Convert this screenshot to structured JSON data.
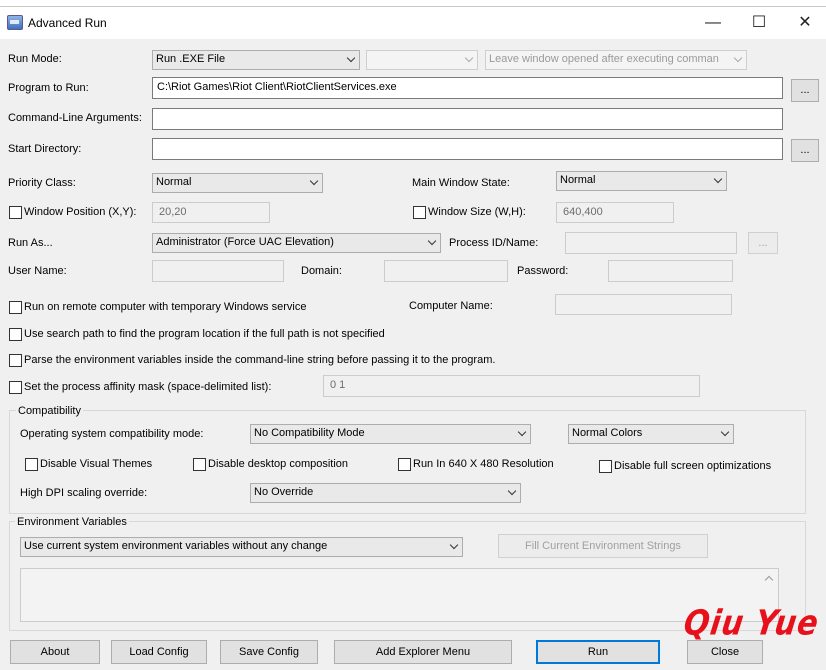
{
  "window": {
    "title": "Advanced Run",
    "controls": {
      "minimize": "—",
      "maximize": "☐",
      "close": "✕"
    }
  },
  "run_mode": {
    "label": "Run Mode:",
    "value": "Run .EXE File",
    "second_combo": "",
    "window_option": "Leave window opened after executing comman"
  },
  "program": {
    "label": "Program to Run:",
    "value": "C:\\Riot Games\\Riot Client\\RiotClientServices.exe",
    "browse": "..."
  },
  "arguments": {
    "label": "Command-Line Arguments:",
    "value": ""
  },
  "start_dir": {
    "label": "Start Directory:",
    "value": "",
    "browse": "..."
  },
  "priority": {
    "label": "Priority Class:",
    "value": "Normal"
  },
  "main_window_state": {
    "label": "Main Window State:",
    "value": "Normal"
  },
  "window_position": {
    "label": "Window Position (X,Y):",
    "value": "20,20",
    "checked": false
  },
  "window_size": {
    "label": "Window Size (W,H):",
    "value": "640,400",
    "checked": false
  },
  "run_as": {
    "label": "Run As...",
    "value": "Administrator (Force UAC Elevation)"
  },
  "process_id": {
    "label": "Process ID/Name:",
    "value": "",
    "browse": "..."
  },
  "credentials": {
    "user_label": "User Name:",
    "domain_label": "Domain:",
    "password_label": "Password:"
  },
  "remote": {
    "label": "Run on remote computer with temporary Windows service",
    "checked": false,
    "computer_label": "Computer Name:"
  },
  "options": [
    {
      "label": "Use search path to find the program location if the full path is not specified",
      "checked": false
    },
    {
      "label": "Parse the environment variables inside the command-line string before passing it to the program.",
      "checked": false
    }
  ],
  "affinity": {
    "label": "Set the process affinity mask (space-delimited list):",
    "value": "0 1",
    "checked": false
  },
  "compatibility": {
    "title": "Compatibility",
    "os_mode_label": "Operating system compatibility mode:",
    "os_mode_value": "No Compatibility Mode",
    "colors_value": "Normal Colors",
    "disable_themes": "Disable Visual Themes",
    "disable_composition": "Disable desktop composition",
    "run_640": "Run In 640 X 480 Resolution",
    "disable_fullscreen": "Disable full screen optimizations",
    "dpi_label": "High DPI scaling override:",
    "dpi_value": "No Override"
  },
  "environment": {
    "title": "Environment Variables",
    "mode_value": "Use current system environment variables without any change",
    "fill_button": "Fill Current Environment Strings",
    "text": ""
  },
  "buttons": {
    "about": "About",
    "load": "Load Config",
    "save": "Save Config",
    "explorer": "Add Explorer Menu",
    "run": "Run",
    "close": "Close"
  },
  "watermark": "Qiu Yue"
}
